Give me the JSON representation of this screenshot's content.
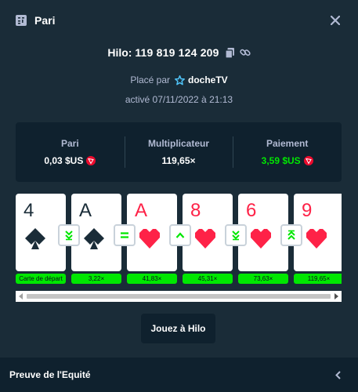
{
  "header": {
    "title": "Pari",
    "icon": "bet-slip-icon",
    "close_icon": "close-icon"
  },
  "bet": {
    "id_prefix": "Hilo:",
    "id_number": "119 819 124 209",
    "copy_icon": "copy-icon",
    "link_icon": "link-icon",
    "placed_by_label": "Placé par",
    "username": "docheTV",
    "user_icon": "vip-star-icon",
    "date_text": "activé 07/11/2022 à 21:13"
  },
  "stats": [
    {
      "label": "Pari",
      "value": "0,03 $US",
      "color": "#ffffff",
      "icon": "tron-coin-icon"
    },
    {
      "label": "Multiplicateur",
      "value": "119,65×",
      "color": "#ffffff"
    },
    {
      "label": "Paiement",
      "value": "3,59 $US",
      "color": "#00e701",
      "icon": "tron-coin-icon"
    }
  ],
  "cards": [
    {
      "rank": "4",
      "suit": "spade",
      "color": "black",
      "multiplier": "Carte de départ"
    },
    {
      "rank": "A",
      "suit": "spade",
      "color": "black",
      "multiplier": "3,22×",
      "guess": "lower-or-same"
    },
    {
      "rank": "A",
      "suit": "heart",
      "color": "red",
      "multiplier": "41,83×",
      "guess": "same"
    },
    {
      "rank": "8",
      "suit": "heart",
      "color": "red",
      "multiplier": "45,31×",
      "guess": "higher"
    },
    {
      "rank": "6",
      "suit": "heart",
      "color": "red",
      "multiplier": "73,63×",
      "guess": "lower-or-same"
    },
    {
      "rank": "9",
      "suit": "heart",
      "color": "red",
      "multiplier": "119,65×",
      "guess": "higher-or-same"
    }
  ],
  "play_button": {
    "label": "Jouez à Hilo"
  },
  "footer": {
    "title": "Preuve de l'Equité",
    "icon": "chevron-left-icon"
  },
  "colors": {
    "background": "#1a2c38",
    "panel": "#0f212e",
    "accent_green": "#00e701",
    "card_red": "#fe2247",
    "muted_text": "#b1bad3"
  }
}
